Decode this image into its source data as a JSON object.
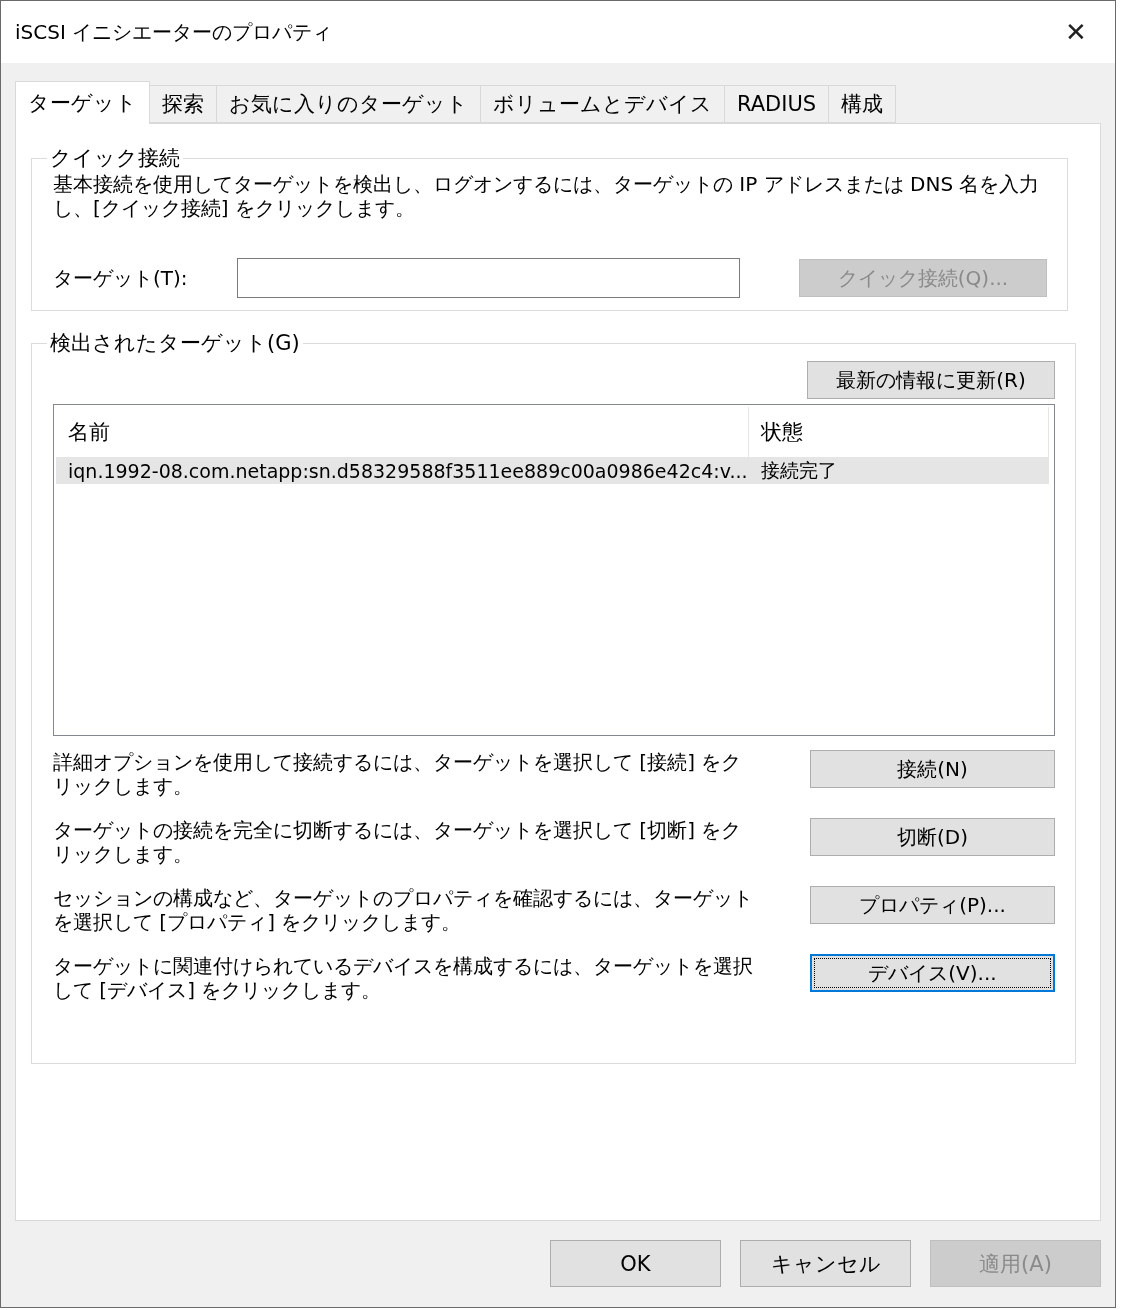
{
  "window": {
    "title": "iSCSI イニシエーターのプロパティ",
    "close": "✕"
  },
  "tabs": [
    {
      "label": "ターゲット",
      "selected": true
    },
    {
      "label": "探索",
      "selected": false
    },
    {
      "label": "お気に入りのターゲット",
      "selected": false
    },
    {
      "label": "ボリュームとデバイス",
      "selected": false
    },
    {
      "label": "RADIUS",
      "selected": false
    },
    {
      "label": "構成",
      "selected": false
    }
  ],
  "quick_connect": {
    "title": "クイック接続",
    "description": "基本接続を使用してターゲットを検出し、ログオンするには、ターゲットの IP アドレスまたは DNS 名を入力し、[クイック接続] をクリックします。",
    "target_label": "ターゲット(T):",
    "button": {
      "label": "クイック接続(Q)...",
      "disabled": true
    }
  },
  "discovered": {
    "title": "検出されたターゲット(G)",
    "refresh_button": {
      "label": "最新の情報に更新(R)",
      "disabled": false
    },
    "table": {
      "columns": [
        "名前",
        "状態"
      ],
      "rows": [
        {
          "name": "iqn.1992-08.com.netapp:sn.d58329588f3511ee889c00a0986e42c4:v...",
          "status": "接続完了",
          "selected": true
        }
      ]
    },
    "actions": [
      {
        "description": "詳細オプションを使用して接続するには、ターゲットを選択して [接続] をクリックします。",
        "button": "接続(N)",
        "focused": false
      },
      {
        "description": "ターゲットの接続を完全に切断するには、ターゲットを選択して [切断] をクリックします。",
        "button": "切断(D)",
        "focused": false
      },
      {
        "description": "セッションの構成など、ターゲットのプロパティを確認するには、ターゲットを選択して [プロパティ] をクリックします。",
        "button": "プロパティ(P)...",
        "focused": false
      },
      {
        "description": "ターゲットに関連付けられているデバイスを構成するには、ターゲットを選択して [デバイス] をクリックします。",
        "button": "デバイス(V)...",
        "focused": true
      }
    ]
  },
  "buttons": [
    {
      "label": "OK",
      "disabled": false
    },
    {
      "label": "キャンセル",
      "disabled": false
    },
    {
      "label": "適用(A)",
      "disabled": true
    }
  ]
}
